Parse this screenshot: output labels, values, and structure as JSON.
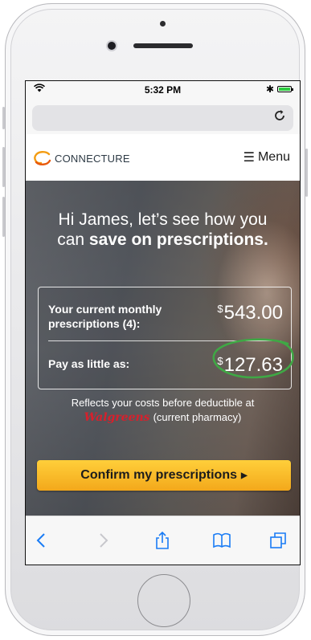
{
  "status_bar": {
    "time": "5:32 PM",
    "wifi_icon": "wifi-icon",
    "bluetooth_icon": "bluetooth-icon",
    "battery_icon": "battery-icon",
    "battery_level": 1.0
  },
  "browser": {
    "reload_icon": "reload-icon"
  },
  "header": {
    "logo_text": "CONNECTURE",
    "menu_label": "Menu",
    "brand_color": "#f39c12"
  },
  "hero": {
    "title_line1": "Hi James, let’s see how you",
    "title_line2_prefix": "can ",
    "title_line2_bold": "save on prescriptions."
  },
  "prices": {
    "current_label": "Your current monthly prescriptions (4):",
    "current_currency": "$",
    "current_amount": "543.00",
    "low_label": "Pay as little as:",
    "low_currency": "$",
    "low_amount": "127.63",
    "highlight_color": "#3fa845"
  },
  "note": {
    "line1": "Reflects your costs before deductible at",
    "pharmacy_logo": "Walgreens",
    "pharmacy_suffix": "(current pharmacy)"
  },
  "cta": {
    "label": "Confirm my prescriptions",
    "accent_color": "#f6b223"
  },
  "toolbar": {
    "icons": [
      "back-icon",
      "forward-icon",
      "share-icon",
      "bookmarks-icon",
      "tabs-icon"
    ],
    "icon_color": "#1a7cf5"
  }
}
